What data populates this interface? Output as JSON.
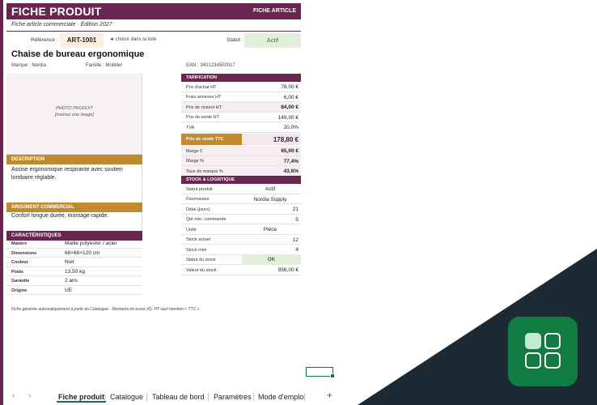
{
  "sheet": {
    "title": "FICHE PRODUIT",
    "title_right": "FICHE ARTICLE",
    "subtitle": "Fiche article commerciale · Édition 2027",
    "reference_label": "Référence :",
    "reference_value": "ART-1001",
    "reference_hint": "◄ choisir dans la liste",
    "status_label": "Statut :",
    "status_value": "Actif",
    "product_name": "Chaise de bureau ergonomique",
    "brand": "Marque : Nordia",
    "family": "Famille : Mobilier",
    "ean": "EAN : 3401234500017",
    "photo_line1": "PHOTO PRODUIT",
    "photo_line2": "[insérez une image]",
    "description_header": "DESCRIPTION",
    "description_text": "Assise ergonomique respirante avec soutien lombaire réglable.",
    "argument_header": "ARGUMENT COMMERCIAL",
    "argument_text": "Confort longue durée, montage rapide.",
    "characteristics_header": "CARACTÉRISTIQUES",
    "characteristics": [
      {
        "key": "Matière",
        "value": "Maille polyester / acier"
      },
      {
        "key": "Dimensions",
        "value": "68×68×120 cm"
      },
      {
        "key": "Couleur",
        "value": "Noir"
      },
      {
        "key": "Poids",
        "value": "13,50 kg"
      },
      {
        "key": "Garantie",
        "value": "2 ans"
      },
      {
        "key": "Origine",
        "value": "UE"
      }
    ],
    "pricing_header": "TARIFICATION",
    "pricing": [
      {
        "key": "Prix d'achat HT",
        "value": "78,00 €"
      },
      {
        "key": "Frais annexes HT",
        "value": "6,00 €"
      },
      {
        "key": "Prix de revient HT",
        "value": "84,00 €"
      },
      {
        "key": "Prix de vente HT",
        "value": "149,00 €"
      },
      {
        "key": "TVA",
        "value": "20,0%"
      }
    ],
    "ttc_label": "Prix de vente TTC",
    "ttc_value": "178,80 €",
    "margins": [
      {
        "key": "Marge €",
        "value": "65,00 €"
      },
      {
        "key": "Marge %",
        "value": "77,4%"
      },
      {
        "key": "Taux de marque %",
        "value": "43,6%"
      }
    ],
    "stock_header": "STOCK & LOGISTIQUE",
    "stock": [
      {
        "key": "Statut produit",
        "value": "Actif"
      },
      {
        "key": "Fournisseur",
        "value": "Nordia Supply"
      },
      {
        "key": "Délai (jours)",
        "value": "21"
      },
      {
        "key": "Qté min. commande",
        "value": "5"
      },
      {
        "key": "Unité",
        "value": "Pièce"
      },
      {
        "key": "Stock actuel",
        "value": "12"
      },
      {
        "key": "Stock mini",
        "value": "4"
      },
      {
        "key": "Statut du stock",
        "value": "OK"
      },
      {
        "key": "Valeur du stock",
        "value": "936,00 €"
      }
    ],
    "footnote": "Fiche générée automatiquement à partir du Catalogue · Montants en euros (€). HT sauf mention « TTC »."
  },
  "tabs": {
    "prev": "‹",
    "next": "›",
    "items": [
      "Fiche produit",
      "Catalogue",
      "Tableau de bord",
      "Paramètres",
      "Mode d'emploi"
    ],
    "add": "+"
  },
  "colors": {
    "brand_purple": "#6a2650",
    "accent_gold": "#c28a2e",
    "ok_green": "#e2efda",
    "app_green": "#107c41"
  }
}
